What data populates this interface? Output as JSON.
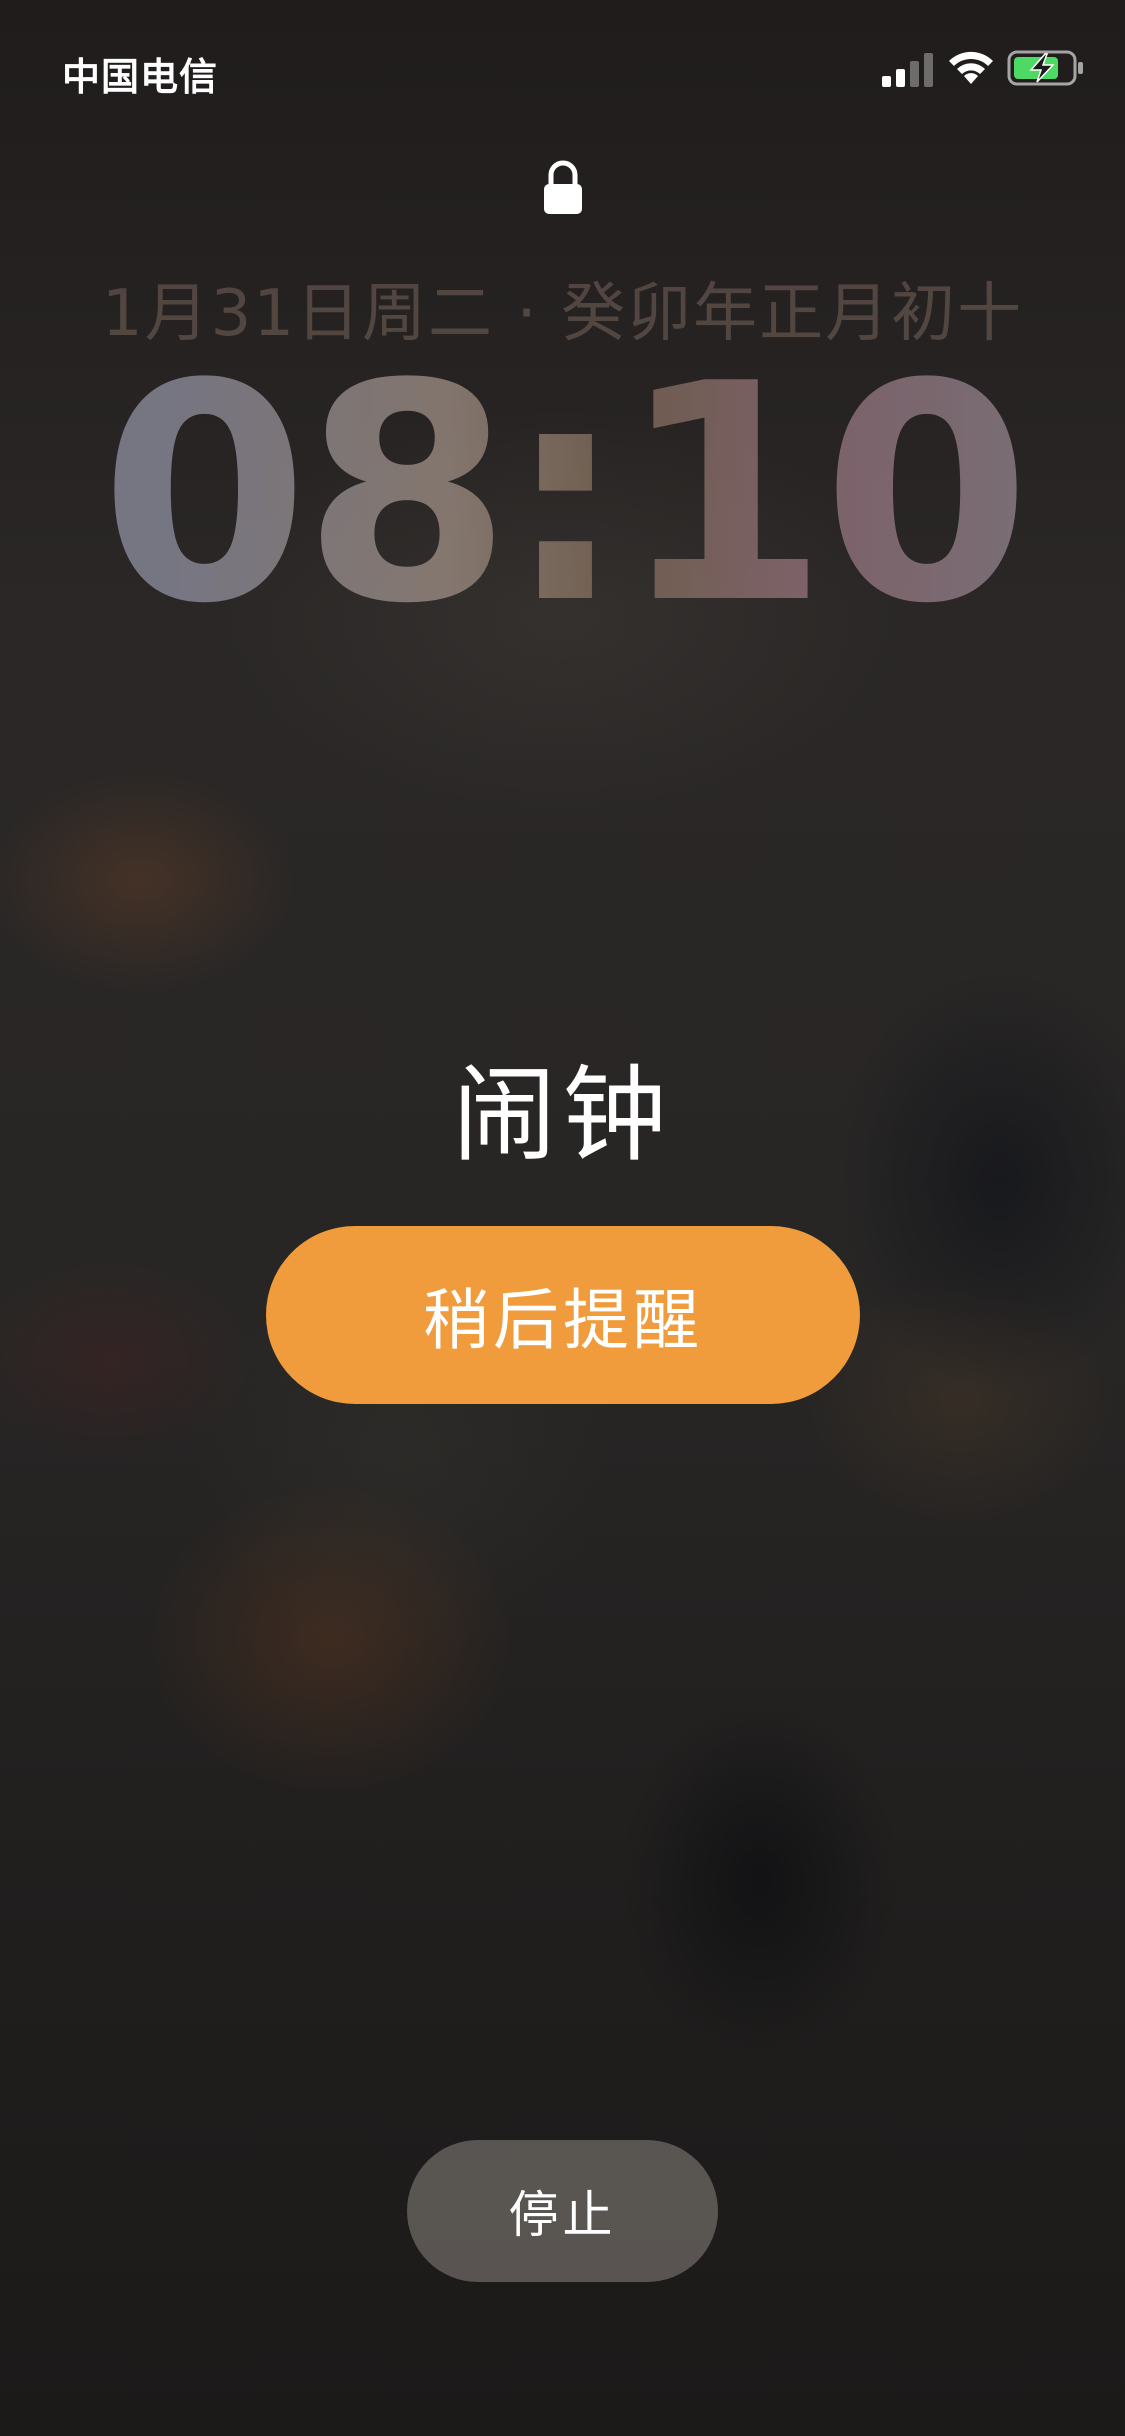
{
  "status_bar": {
    "carrier": "中国电信",
    "signal_bars_active": 2,
    "signal_bars_total": 4,
    "wifi_icon": "wifi-icon",
    "battery_icon": "battery-charging-icon",
    "battery_level": 0.75,
    "battery_color": "#4cd964"
  },
  "lock_screen": {
    "lock_icon": "lock-icon",
    "date": "1月31日周二 · 癸卯年正月初十",
    "time": "08:10"
  },
  "alarm": {
    "title": "闹钟",
    "snooze_label": "稍后提醒",
    "stop_label": "停止",
    "accent_color": "#f09c3c"
  }
}
